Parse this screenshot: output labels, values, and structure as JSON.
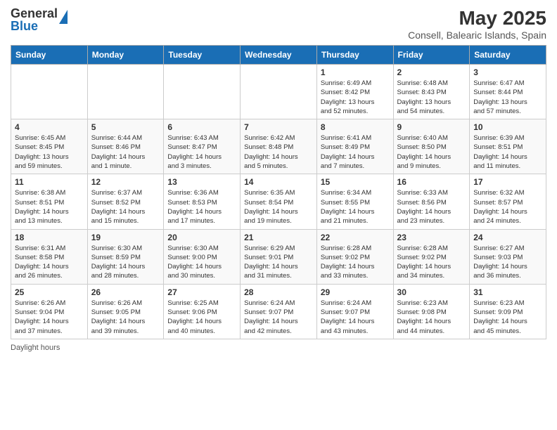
{
  "logo": {
    "general": "General",
    "blue": "Blue"
  },
  "title": "May 2025",
  "subtitle": "Consell, Balearic Islands, Spain",
  "days_of_week": [
    "Sunday",
    "Monday",
    "Tuesday",
    "Wednesday",
    "Thursday",
    "Friday",
    "Saturday"
  ],
  "weeks": [
    [
      {
        "day": "",
        "info": ""
      },
      {
        "day": "",
        "info": ""
      },
      {
        "day": "",
        "info": ""
      },
      {
        "day": "",
        "info": ""
      },
      {
        "day": "1",
        "info": "Sunrise: 6:49 AM\nSunset: 8:42 PM\nDaylight: 13 hours\nand 52 minutes."
      },
      {
        "day": "2",
        "info": "Sunrise: 6:48 AM\nSunset: 8:43 PM\nDaylight: 13 hours\nand 54 minutes."
      },
      {
        "day": "3",
        "info": "Sunrise: 6:47 AM\nSunset: 8:44 PM\nDaylight: 13 hours\nand 57 minutes."
      }
    ],
    [
      {
        "day": "4",
        "info": "Sunrise: 6:45 AM\nSunset: 8:45 PM\nDaylight: 13 hours\nand 59 minutes."
      },
      {
        "day": "5",
        "info": "Sunrise: 6:44 AM\nSunset: 8:46 PM\nDaylight: 14 hours\nand 1 minute."
      },
      {
        "day": "6",
        "info": "Sunrise: 6:43 AM\nSunset: 8:47 PM\nDaylight: 14 hours\nand 3 minutes."
      },
      {
        "day": "7",
        "info": "Sunrise: 6:42 AM\nSunset: 8:48 PM\nDaylight: 14 hours\nand 5 minutes."
      },
      {
        "day": "8",
        "info": "Sunrise: 6:41 AM\nSunset: 8:49 PM\nDaylight: 14 hours\nand 7 minutes."
      },
      {
        "day": "9",
        "info": "Sunrise: 6:40 AM\nSunset: 8:50 PM\nDaylight: 14 hours\nand 9 minutes."
      },
      {
        "day": "10",
        "info": "Sunrise: 6:39 AM\nSunset: 8:51 PM\nDaylight: 14 hours\nand 11 minutes."
      }
    ],
    [
      {
        "day": "11",
        "info": "Sunrise: 6:38 AM\nSunset: 8:51 PM\nDaylight: 14 hours\nand 13 minutes."
      },
      {
        "day": "12",
        "info": "Sunrise: 6:37 AM\nSunset: 8:52 PM\nDaylight: 14 hours\nand 15 minutes."
      },
      {
        "day": "13",
        "info": "Sunrise: 6:36 AM\nSunset: 8:53 PM\nDaylight: 14 hours\nand 17 minutes."
      },
      {
        "day": "14",
        "info": "Sunrise: 6:35 AM\nSunset: 8:54 PM\nDaylight: 14 hours\nand 19 minutes."
      },
      {
        "day": "15",
        "info": "Sunrise: 6:34 AM\nSunset: 8:55 PM\nDaylight: 14 hours\nand 21 minutes."
      },
      {
        "day": "16",
        "info": "Sunrise: 6:33 AM\nSunset: 8:56 PM\nDaylight: 14 hours\nand 23 minutes."
      },
      {
        "day": "17",
        "info": "Sunrise: 6:32 AM\nSunset: 8:57 PM\nDaylight: 14 hours\nand 24 minutes."
      }
    ],
    [
      {
        "day": "18",
        "info": "Sunrise: 6:31 AM\nSunset: 8:58 PM\nDaylight: 14 hours\nand 26 minutes."
      },
      {
        "day": "19",
        "info": "Sunrise: 6:30 AM\nSunset: 8:59 PM\nDaylight: 14 hours\nand 28 minutes."
      },
      {
        "day": "20",
        "info": "Sunrise: 6:30 AM\nSunset: 9:00 PM\nDaylight: 14 hours\nand 30 minutes."
      },
      {
        "day": "21",
        "info": "Sunrise: 6:29 AM\nSunset: 9:01 PM\nDaylight: 14 hours\nand 31 minutes."
      },
      {
        "day": "22",
        "info": "Sunrise: 6:28 AM\nSunset: 9:02 PM\nDaylight: 14 hours\nand 33 minutes."
      },
      {
        "day": "23",
        "info": "Sunrise: 6:28 AM\nSunset: 9:02 PM\nDaylight: 14 hours\nand 34 minutes."
      },
      {
        "day": "24",
        "info": "Sunrise: 6:27 AM\nSunset: 9:03 PM\nDaylight: 14 hours\nand 36 minutes."
      }
    ],
    [
      {
        "day": "25",
        "info": "Sunrise: 6:26 AM\nSunset: 9:04 PM\nDaylight: 14 hours\nand 37 minutes."
      },
      {
        "day": "26",
        "info": "Sunrise: 6:26 AM\nSunset: 9:05 PM\nDaylight: 14 hours\nand 39 minutes."
      },
      {
        "day": "27",
        "info": "Sunrise: 6:25 AM\nSunset: 9:06 PM\nDaylight: 14 hours\nand 40 minutes."
      },
      {
        "day": "28",
        "info": "Sunrise: 6:24 AM\nSunset: 9:07 PM\nDaylight: 14 hours\nand 42 minutes."
      },
      {
        "day": "29",
        "info": "Sunrise: 6:24 AM\nSunset: 9:07 PM\nDaylight: 14 hours\nand 43 minutes."
      },
      {
        "day": "30",
        "info": "Sunrise: 6:23 AM\nSunset: 9:08 PM\nDaylight: 14 hours\nand 44 minutes."
      },
      {
        "day": "31",
        "info": "Sunrise: 6:23 AM\nSunset: 9:09 PM\nDaylight: 14 hours\nand 45 minutes."
      }
    ]
  ],
  "footer": {
    "daylight_label": "Daylight hours"
  }
}
